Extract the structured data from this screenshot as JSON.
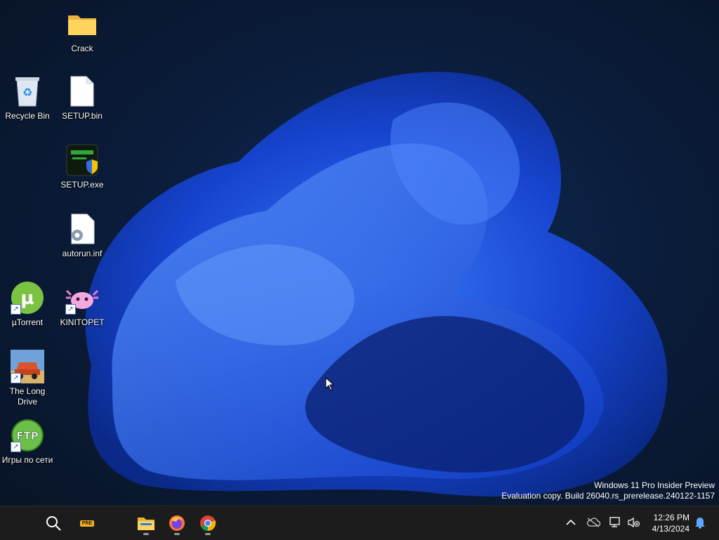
{
  "desktop_icons": [
    {
      "label": "Crack",
      "icon": "folder-icon"
    },
    {
      "label": "Recycle Bin",
      "icon": "recycle-bin-icon"
    },
    {
      "label": "SETUP.bin",
      "icon": "file-icon"
    },
    {
      "label": "SETUP.exe",
      "icon": "setup-exe-icon"
    },
    {
      "label": "autorun.inf",
      "icon": "config-file-icon"
    },
    {
      "label": "µTorrent",
      "icon": "utorrent-icon"
    },
    {
      "label": "KINITOPET",
      "icon": "kinitopet-icon"
    },
    {
      "label": "The Long Drive",
      "icon": "the-long-drive-icon"
    },
    {
      "label": "Игры по сети",
      "icon": "ftp-icon"
    }
  ],
  "watermark": {
    "line1": "Windows 11 Pro Insider Preview",
    "line2": "Evaluation copy. Build 26040.rs_prerelease.240122-1157"
  },
  "taskbar": {
    "search_icon": "search-icon",
    "pre_badge": "PRE",
    "apps": [
      {
        "name": "File Explorer",
        "icon": "file-explorer-icon"
      },
      {
        "name": "Firefox",
        "icon": "firefox-icon"
      },
      {
        "name": "Chrome",
        "icon": "chrome-icon"
      }
    ],
    "tray_icons": [
      "chevron-up-icon",
      "cloud-offline-icon",
      "network-icon",
      "volume-muted-icon",
      "notification-bell-icon"
    ],
    "clock": {
      "time": "12:26 PM",
      "date": "4/13/2024"
    }
  },
  "colors": {
    "taskbar": "#1c1c1c",
    "wallpaper_accent": "#1e5fff",
    "background": "#0b1d3c"
  }
}
